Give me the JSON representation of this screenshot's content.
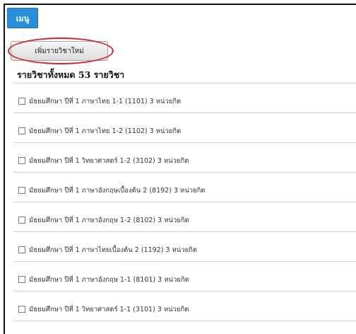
{
  "menu": {
    "label": "เมนู"
  },
  "actions": {
    "add_course_label": "เพิ่มรายวิชาใหม่"
  },
  "list": {
    "heading": "รายวิชาทั้งหมด 53 รายวิชา",
    "courses": [
      "มัธยมศึกษา ปีที่ 1 ภาษาไทย 1-1 (1101) 3 หน่วยกิต",
      "มัธยมศึกษา ปีที่ 1 ภาษาไทย 1-2 (1102) 3 หน่วยกิต",
      "มัธยมศึกษา ปีที่ 1 วิทยาศาสตร์ 1-2 (3102) 3 หน่วยกิต",
      "มัธยมศึกษา ปีที่ 1 ภาษาอังกฤษเบื้องต้น 2 (8192) 3 หน่วยกิต",
      "มัธยมศึกษา ปีที่ 1 ภาษาอังกฤษ 1-2 (8102) 3 หน่วยกิต",
      "มัธยมศึกษา ปีที่ 1 ภาษาไทยเบื้องต้น 2 (1192) 3 หน่วยกิต",
      "มัธยมศึกษา ปีที่ 1 ภาษาอังกฤษ 1-1 (8101) 3 หน่วยกิต",
      "มัธยมศึกษา ปีที่ 1 วิทยาศาสตร์ 1-1 (3101) 3 หน่วยกิต"
    ]
  },
  "colors": {
    "menu_button": "#2a8ed8",
    "highlight": "#d2232a"
  }
}
